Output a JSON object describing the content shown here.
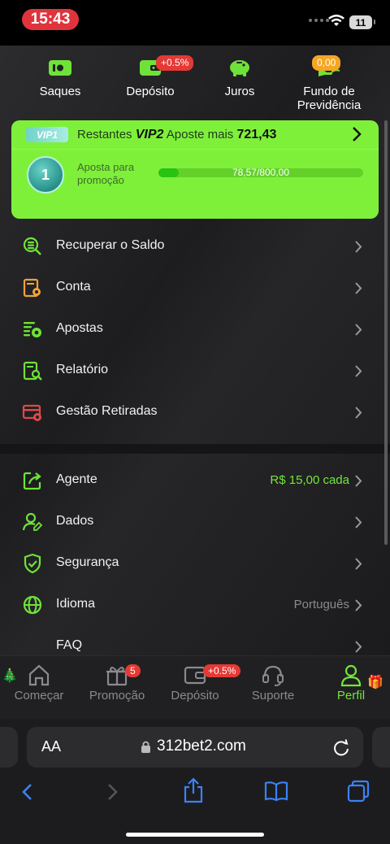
{
  "status_bar": {
    "time": "15:43",
    "battery": "11"
  },
  "quick_actions": [
    {
      "label": "Saques",
      "badge": ""
    },
    {
      "label": "Depósito",
      "badge": "+0.5%"
    },
    {
      "label": "Juros",
      "badge": ""
    },
    {
      "label": "Fundo de Previdência",
      "badge": "0,00"
    }
  ],
  "vip": {
    "chip": "VIP1",
    "remaining_prefix": "Restantes",
    "next_level": "VIP2",
    "bet_more": "Aposte mais",
    "amount": "721,43",
    "medal_level": "1",
    "promo_label": "Aposta para promoção",
    "progress_text": "78,57/800,00",
    "progress_fraction": 0.098
  },
  "menu": {
    "recover": "Recuperar o Saldo",
    "account": "Conta",
    "bets": "Apostas",
    "report": "Relatório",
    "withdrawals": "Gestão Retiradas",
    "agent": "Agente",
    "agent_value": "R$ 15,00 cada",
    "data": "Dados",
    "security": "Segurança",
    "language": "Idioma",
    "language_value": "Português",
    "faq": "FAQ"
  },
  "tabs": {
    "start": "Começar",
    "promo": "Promoção",
    "promo_badge": "5",
    "deposit": "Depósito",
    "deposit_badge": "+0.5%",
    "support": "Suporte",
    "profile": "Perfil"
  },
  "browser": {
    "text_size": "AA",
    "url": "312bet2.com"
  },
  "colors": {
    "accent": "#74e63a",
    "card": "#7ff03a",
    "badge": "#e53935"
  }
}
